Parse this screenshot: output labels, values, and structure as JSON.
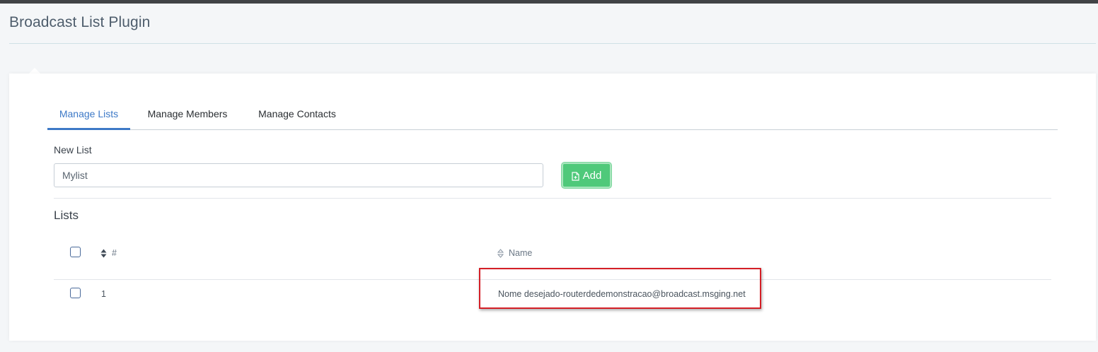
{
  "page": {
    "title": "Broadcast List Plugin"
  },
  "tabs": [
    {
      "label": "Manage Lists",
      "active": true
    },
    {
      "label": "Manage Members",
      "active": false
    },
    {
      "label": "Manage Contacts",
      "active": false
    }
  ],
  "new_list": {
    "label": "New List",
    "input_value": "Mylist",
    "add_button_label": "Add"
  },
  "lists": {
    "title": "Lists",
    "columns": {
      "index": "#",
      "name": "Name"
    },
    "rows": [
      {
        "index": "1",
        "name": "Nome desejado-routerdedemonstracao@broadcast.msging.net"
      }
    ]
  },
  "colors": {
    "accent": "#3d79c7",
    "add_button": "#4fc97a",
    "highlight": "#d41f26"
  }
}
